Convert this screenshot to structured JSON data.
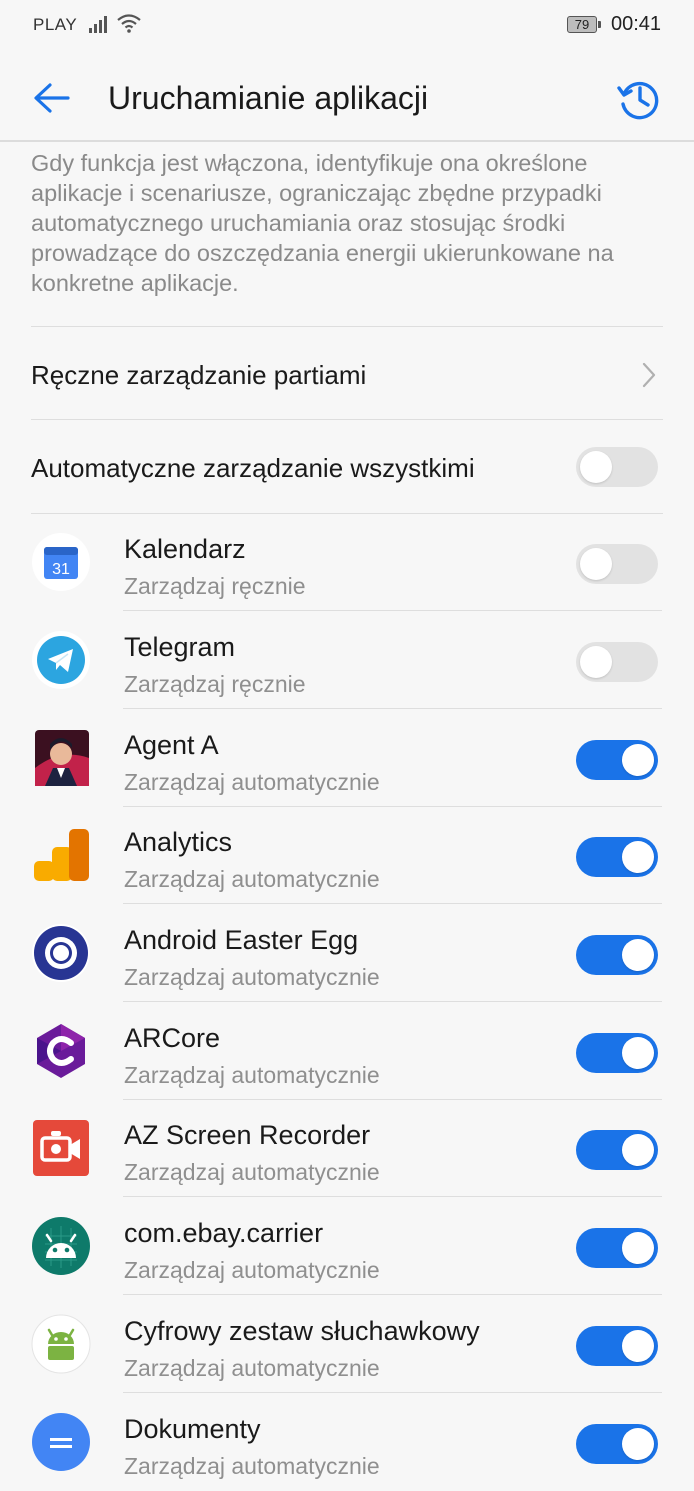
{
  "status_bar": {
    "carrier": "PLAY",
    "battery": "79",
    "time": "00:41"
  },
  "header": {
    "title": "Uruchamianie aplikacji",
    "back_icon": "back-arrow-icon",
    "history_icon": "history-icon",
    "accent": "#1a73e8"
  },
  "description": "Gdy funkcja jest włączona, identyfikuje ona określone aplikacje i scenariusze, ograniczając zbędne przypadki automatycznego uruchamiania oraz stosując środki prowadzące do oszczędzania energii ukierunkowane na konkretne aplikacje.",
  "manual_batch": {
    "label": "Ręczne zarządzanie partiami"
  },
  "auto_all": {
    "label": "Automatyczne zarządzanie wszystkimi",
    "enabled": false
  },
  "apps": [
    {
      "name": "Kalendarz",
      "status": "Zarządzaj ręcznie",
      "enabled": false,
      "icon": "calendar-icon",
      "icon_text": "31"
    },
    {
      "name": "Telegram",
      "status": "Zarządzaj ręcznie",
      "enabled": false,
      "icon": "telegram-icon"
    },
    {
      "name": "Agent A",
      "status": "Zarządzaj automatycznie",
      "enabled": true,
      "icon": "agent-a-icon"
    },
    {
      "name": "Analytics",
      "status": "Zarządzaj automatycznie",
      "enabled": true,
      "icon": "analytics-icon"
    },
    {
      "name": "Android Easter Egg",
      "status": "Zarządzaj automatycznie",
      "enabled": true,
      "icon": "easter-egg-icon"
    },
    {
      "name": "ARCore",
      "status": "Zarządzaj automatycznie",
      "enabled": true,
      "icon": "arcore-icon"
    },
    {
      "name": "AZ Screen Recorder",
      "status": "Zarządzaj automatycznie",
      "enabled": true,
      "icon": "screen-recorder-icon"
    },
    {
      "name": "com.ebay.carrier",
      "status": "Zarządzaj automatycznie",
      "enabled": true,
      "icon": "android-icon"
    },
    {
      "name": "Cyfrowy zestaw słuchawkowy",
      "status": "Zarządzaj automatycznie",
      "enabled": true,
      "icon": "android-icon"
    },
    {
      "name": "Dokumenty",
      "status": "Zarządzaj automatycznie",
      "enabled": true,
      "icon": "docs-icon"
    }
  ]
}
